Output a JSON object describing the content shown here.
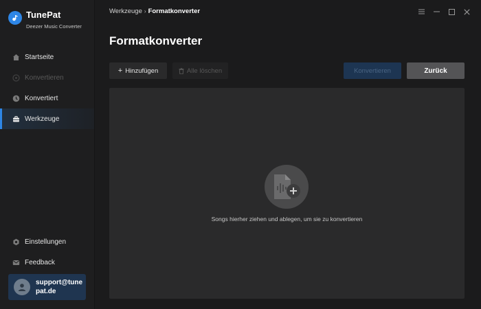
{
  "app": {
    "name": "TunePat",
    "subtitle": "Deezer Music Converter"
  },
  "sidebar": {
    "items": [
      {
        "label": "Startseite",
        "icon": "home-icon",
        "state": "normal"
      },
      {
        "label": "Konvertieren",
        "icon": "convert-icon",
        "state": "disabled"
      },
      {
        "label": "Konvertiert",
        "icon": "clock-icon",
        "state": "normal"
      },
      {
        "label": "Werkzeuge",
        "icon": "toolbox-icon",
        "state": "active"
      }
    ],
    "bottom_items": [
      {
        "label": "Einstellungen",
        "icon": "settings-icon"
      },
      {
        "label": "Feedback",
        "icon": "mail-icon"
      }
    ],
    "user": {
      "email": "support@tunepat.de"
    }
  },
  "header": {
    "breadcrumb": [
      "Werkzeuge",
      "Formatkonverter"
    ],
    "breadcrumb_separator": "›"
  },
  "main": {
    "title": "Formatkonverter",
    "toolbar": {
      "add_label": "Hinzufügen",
      "clear_label": "Alle löschen",
      "convert_label": "Konvertieren",
      "back_label": "Zurück"
    },
    "dropzone": {
      "hint": "Songs hierher ziehen und ablegen, um sie zu konvertieren"
    }
  },
  "colors": {
    "accent": "#2e86e6",
    "background": "#1b1b1c",
    "sidebar": "#1e1e1f",
    "dropzone": "#2a2a2b"
  }
}
